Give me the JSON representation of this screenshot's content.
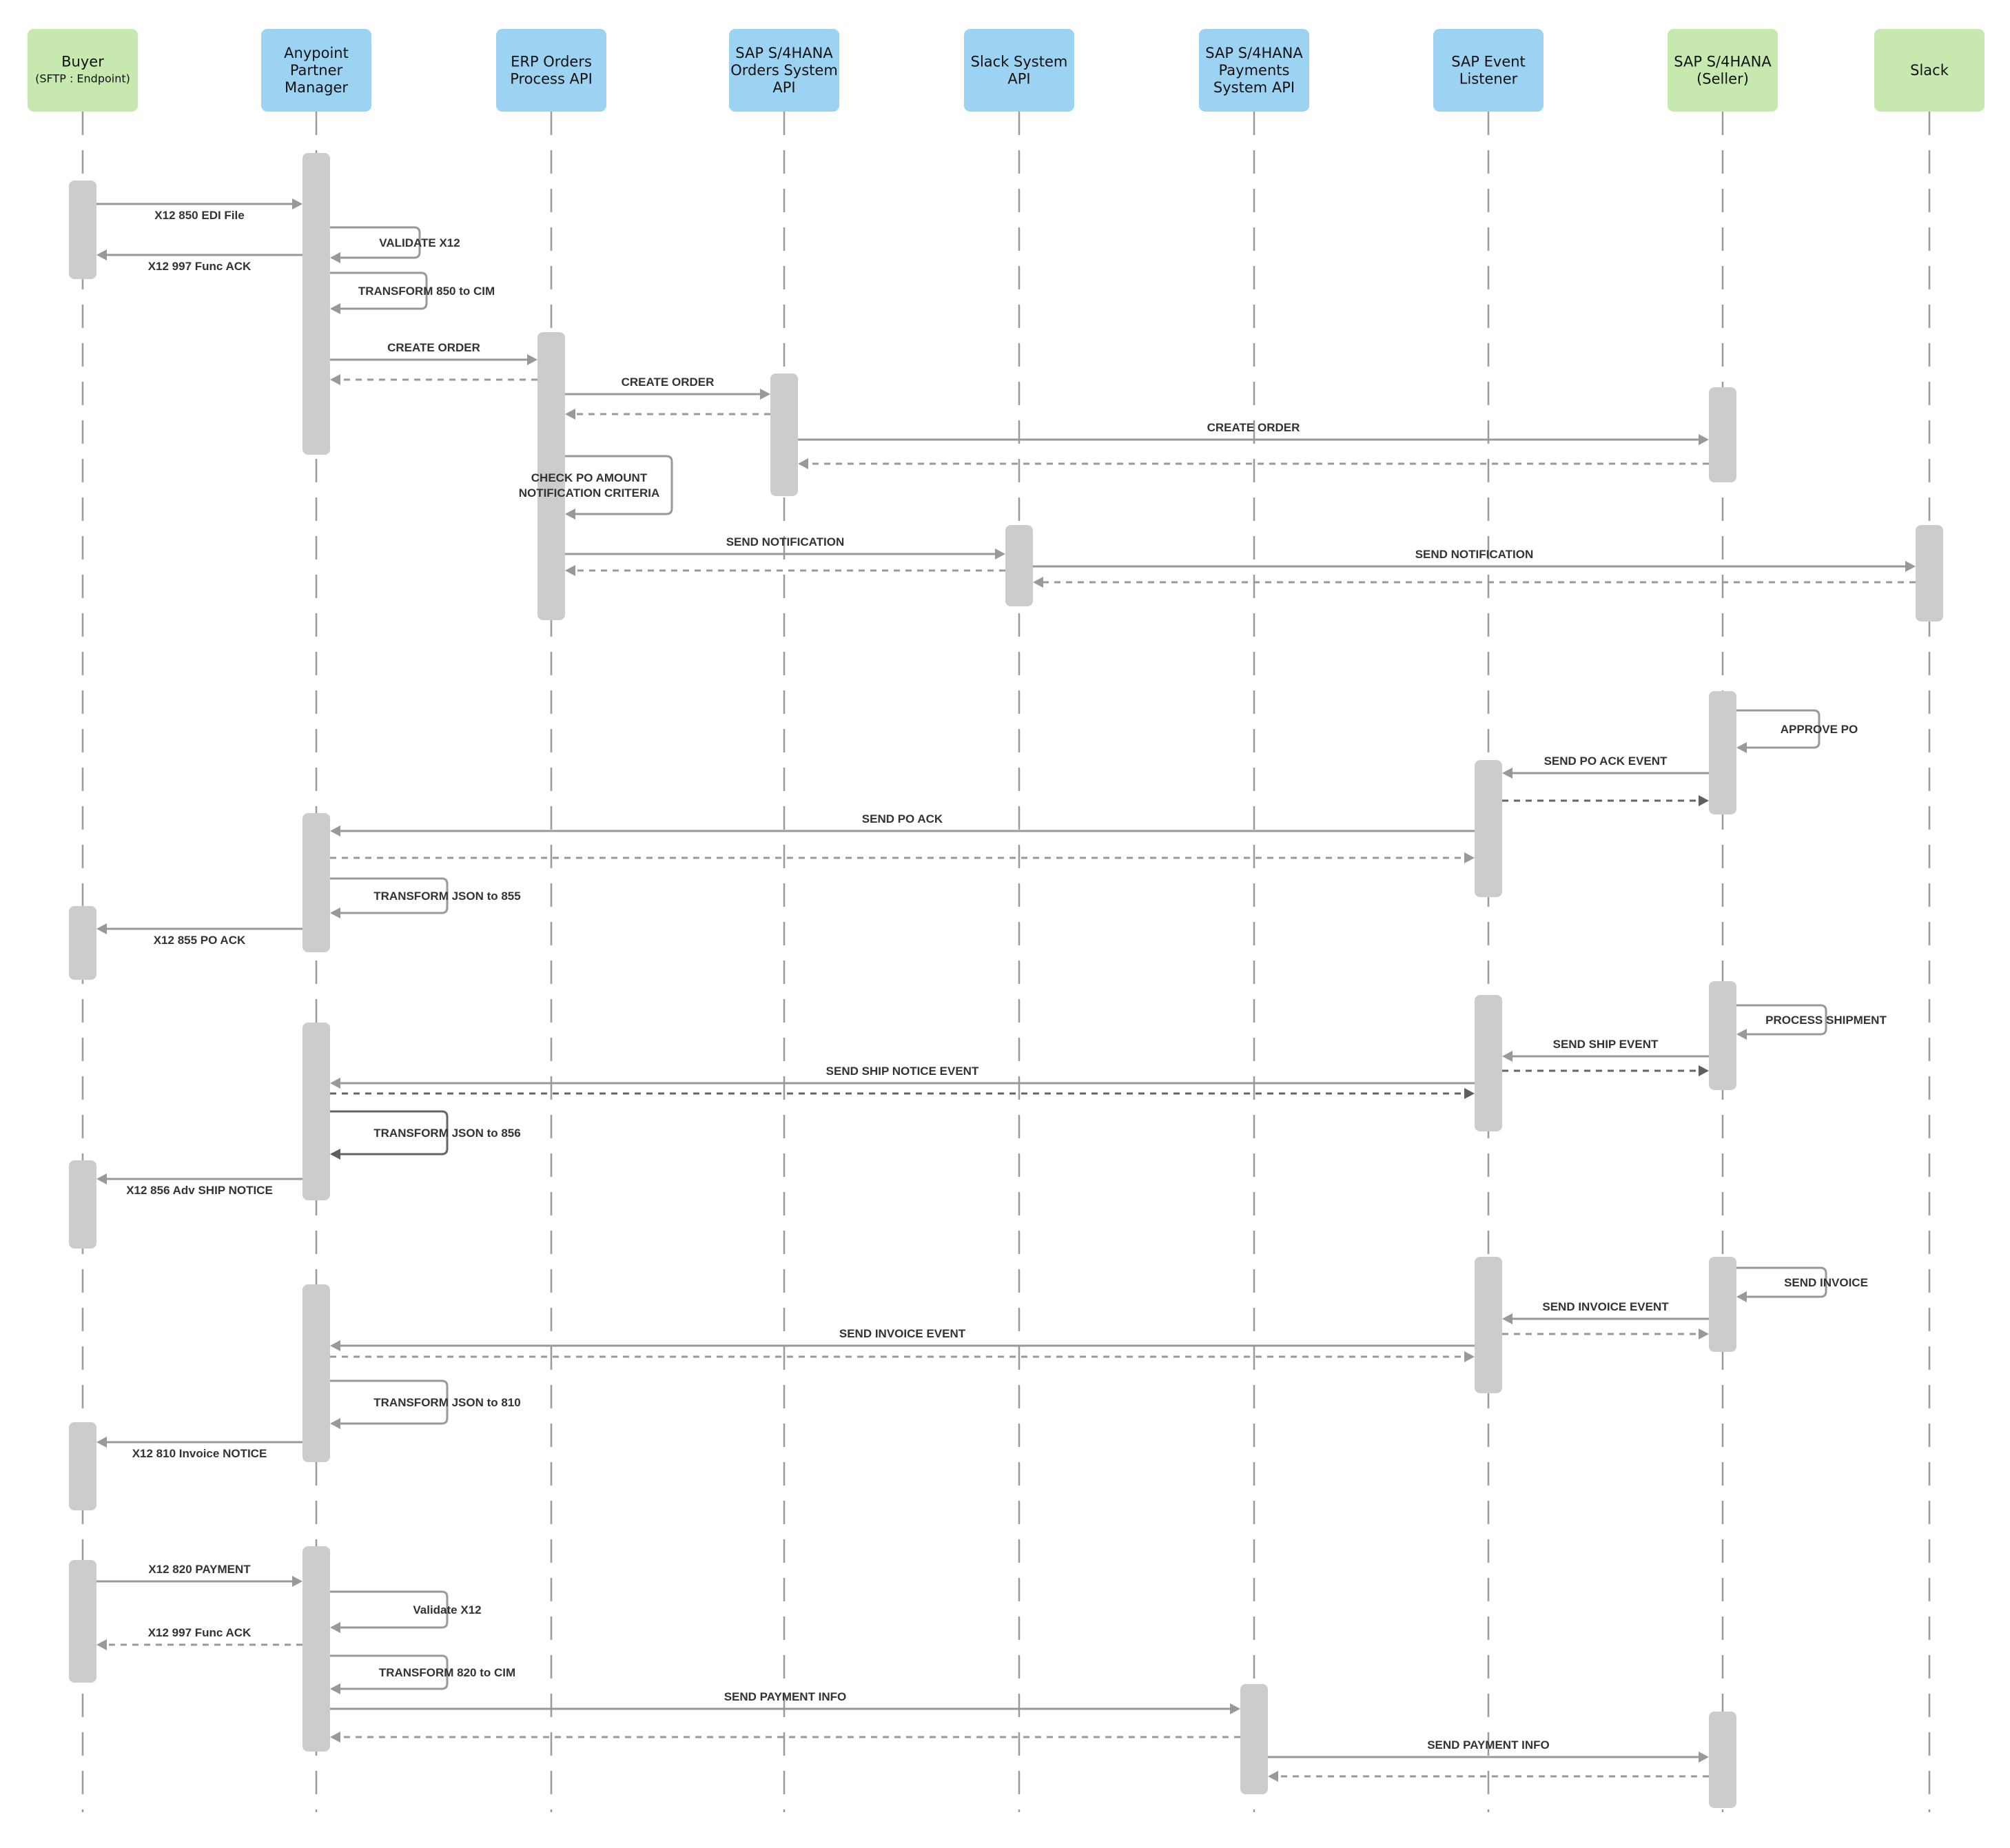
{
  "colors": {
    "system_box": "#9dd3f2",
    "external_box": "#c7e8ae",
    "activation": "#cccccc",
    "arrow": "#999999",
    "arrow_dark": "#5f5f5f",
    "label_text": "#333333"
  },
  "participants": [
    {
      "id": "buyer",
      "lines": [
        "Buyer"
      ],
      "sub": "(SFTP : Endpoint)",
      "kind": "external"
    },
    {
      "id": "apm",
      "lines": [
        "Anypoint",
        "Partner",
        "Manager"
      ],
      "kind": "system"
    },
    {
      "id": "erp",
      "lines": [
        "ERP Orders",
        "Process API"
      ],
      "kind": "system"
    },
    {
      "id": "sap_orders",
      "lines": [
        "SAP S/4HANA",
        "Orders System",
        "API"
      ],
      "kind": "system"
    },
    {
      "id": "slack_api",
      "lines": [
        "Slack System",
        "API"
      ],
      "kind": "system"
    },
    {
      "id": "sap_payments",
      "lines": [
        "SAP S/4HANA",
        "Payments",
        "System API"
      ],
      "kind": "system"
    },
    {
      "id": "sap_listener",
      "lines": [
        "SAP Event",
        "Listener"
      ],
      "kind": "system"
    },
    {
      "id": "sap_seller",
      "lines": [
        "SAP S/4HANA",
        "(Seller)"
      ],
      "kind": "external"
    },
    {
      "id": "slack",
      "lines": [
        "Slack"
      ],
      "kind": "external"
    }
  ],
  "activations": [
    {
      "participant": "buyer",
      "start": 1,
      "end": 4
    },
    {
      "participant": "apm",
      "start": 0,
      "end": 10
    },
    {
      "participant": "erp",
      "start": 6,
      "end": 20
    },
    {
      "participant": "sap_orders",
      "start": 8,
      "end": 14
    },
    {
      "participant": "sap_seller",
      "start": 9,
      "end": 13
    },
    {
      "participant": "slack_api",
      "start": 15,
      "end": 19
    },
    {
      "participant": "slack",
      "start": 15,
      "end": 20
    },
    {
      "participant": "sap_seller",
      "start": 22,
      "end": 28
    },
    {
      "participant": "sap_listener",
      "start": 25,
      "end": 32
    },
    {
      "participant": "apm",
      "start": 27,
      "end": 34
    },
    {
      "participant": "buyer",
      "start": 32,
      "end": 36
    },
    {
      "participant": "sap_seller",
      "start": 37,
      "end": 43
    },
    {
      "participant": "sap_listener",
      "start": 37,
      "end": 44
    },
    {
      "participant": "apm",
      "start": 38,
      "end": 47
    },
    {
      "participant": "buyer",
      "start": 46,
      "end": 51
    },
    {
      "participant": "sap_seller",
      "start": 52,
      "end": 57
    },
    {
      "participant": "sap_listener",
      "start": 52,
      "end": 59
    },
    {
      "participant": "apm",
      "start": 53,
      "end": 62
    },
    {
      "participant": "buyer",
      "start": 60,
      "end": 65
    },
    {
      "participant": "buyer",
      "start": 66,
      "end": 72
    },
    {
      "participant": "apm",
      "start": 66,
      "end": 76
    },
    {
      "participant": "sap_payments",
      "start": 73,
      "end": 78
    },
    {
      "participant": "sap_seller",
      "start": 74,
      "end": 79
    }
  ],
  "messages": [
    {
      "from": "buyer",
      "to": "apm",
      "label": "X12 850 EDI File",
      "type": "sync",
      "label_pos": "below"
    },
    {
      "from": "apm",
      "to": "apm",
      "label": "VALIDATE X12",
      "type": "self"
    },
    {
      "from": "apm",
      "to": "buyer",
      "label": "X12 997 Func ACK",
      "type": "sync",
      "label_pos": "below"
    },
    {
      "from": "apm",
      "to": "apm",
      "label": "TRANSFORM 850 to CIM",
      "type": "self"
    },
    {
      "from": "apm",
      "to": "erp",
      "label": "CREATE ORDER",
      "type": "sync"
    },
    {
      "from": "erp",
      "to": "apm",
      "label": "",
      "type": "return"
    },
    {
      "from": "erp",
      "to": "sap_orders",
      "label": "CREATE ORDER",
      "type": "sync"
    },
    {
      "from": "sap_orders",
      "to": "erp",
      "label": "",
      "type": "return"
    },
    {
      "from": "sap_orders",
      "to": "sap_seller",
      "label": "CREATE ORDER",
      "type": "sync"
    },
    {
      "from": "sap_seller",
      "to": "sap_orders",
      "label": "",
      "type": "return"
    },
    {
      "from": "erp",
      "to": "erp",
      "label": "CHECK PO AMOUNT\nNOTIFICATION CRITERIA",
      "type": "self"
    },
    {
      "from": "erp",
      "to": "slack_api",
      "label": "SEND NOTIFICATION",
      "type": "sync"
    },
    {
      "from": "slack_api",
      "to": "erp",
      "label": "",
      "type": "return"
    },
    {
      "from": "slack_api",
      "to": "slack",
      "label": "SEND NOTIFICATION",
      "type": "sync"
    },
    {
      "from": "slack",
      "to": "slack_api",
      "label": "",
      "type": "return"
    },
    {
      "from": "sap_seller",
      "to": "sap_seller",
      "label": "APPROVE PO",
      "type": "self"
    },
    {
      "from": "sap_seller",
      "to": "sap_listener",
      "label": "SEND PO ACK EVENT",
      "type": "sync"
    },
    {
      "from": "sap_listener",
      "to": "sap_seller",
      "label": "",
      "type": "return",
      "dark": true
    },
    {
      "from": "sap_listener",
      "to": "apm",
      "label": "SEND PO ACK",
      "type": "sync"
    },
    {
      "from": "apm",
      "to": "sap_listener",
      "label": "",
      "type": "return"
    },
    {
      "from": "apm",
      "to": "apm",
      "label": "TRANSFORM JSON to 855",
      "type": "self"
    },
    {
      "from": "apm",
      "to": "buyer",
      "label": "X12 855 PO ACK",
      "type": "sync",
      "label_pos": "below"
    },
    {
      "from": "sap_seller",
      "to": "sap_seller",
      "label": "PROCESS SHIPMENT",
      "type": "self"
    },
    {
      "from": "sap_seller",
      "to": "sap_listener",
      "label": "SEND SHIP EVENT",
      "type": "sync"
    },
    {
      "from": "sap_listener",
      "to": "sap_seller",
      "label": "",
      "type": "return",
      "dark": true
    },
    {
      "from": "sap_listener",
      "to": "apm",
      "label": "SEND SHIP NOTICE EVENT",
      "type": "sync"
    },
    {
      "from": "apm",
      "to": "sap_listener",
      "label": "",
      "type": "return",
      "dark": true
    },
    {
      "from": "apm",
      "to": "apm",
      "label": "TRANSFORM JSON to 856",
      "type": "self",
      "dark": true
    },
    {
      "from": "apm",
      "to": "buyer",
      "label": "X12 856 Adv SHIP NOTICE",
      "type": "sync",
      "label_pos": "below"
    },
    {
      "from": "sap_seller",
      "to": "sap_seller",
      "label": "SEND INVOICE",
      "type": "self"
    },
    {
      "from": "sap_seller",
      "to": "sap_listener",
      "label": "SEND INVOICE EVENT",
      "type": "sync"
    },
    {
      "from": "sap_listener",
      "to": "sap_seller",
      "label": "",
      "type": "return"
    },
    {
      "from": "sap_listener",
      "to": "apm",
      "label": "SEND INVOICE EVENT",
      "type": "sync"
    },
    {
      "from": "apm",
      "to": "sap_listener",
      "label": "",
      "type": "return"
    },
    {
      "from": "apm",
      "to": "apm",
      "label": "TRANSFORM JSON to 810",
      "type": "self"
    },
    {
      "from": "apm",
      "to": "buyer",
      "label": "X12 810 Invoice NOTICE",
      "type": "sync",
      "label_pos": "below"
    },
    {
      "from": "buyer",
      "to": "apm",
      "label": "X12 820 PAYMENT",
      "type": "sync"
    },
    {
      "from": "apm",
      "to": "apm",
      "label": "Validate X12",
      "type": "self"
    },
    {
      "from": "apm",
      "to": "buyer",
      "label": "X12 997 Func ACK",
      "type": "return"
    },
    {
      "from": "apm",
      "to": "apm",
      "label": "TRANSFORM 820 to CIM",
      "type": "self"
    },
    {
      "from": "apm",
      "to": "sap_payments",
      "label": "SEND PAYMENT INFO",
      "type": "sync"
    },
    {
      "from": "sap_payments",
      "to": "apm",
      "label": "",
      "type": "return"
    },
    {
      "from": "sap_payments",
      "to": "sap_seller",
      "label": "SEND PAYMENT INFO",
      "type": "sync"
    },
    {
      "from": "sap_seller",
      "to": "sap_payments",
      "label": "",
      "type": "return"
    }
  ]
}
